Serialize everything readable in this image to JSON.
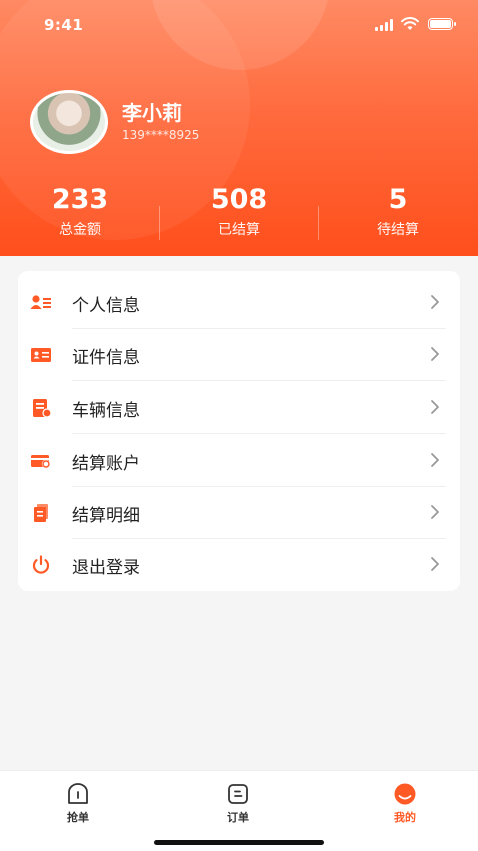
{
  "status_bar": {
    "time": "9:41"
  },
  "profile": {
    "name": "李小莉",
    "phone": "139****8925"
  },
  "stats": [
    {
      "value": "233",
      "label": "总金额"
    },
    {
      "value": "508",
      "label": "已结算"
    },
    {
      "value": "5",
      "label": "待结算"
    }
  ],
  "menu": {
    "items": [
      {
        "label": "个人信息",
        "icon": "person-card-icon"
      },
      {
        "label": "证件信息",
        "icon": "id-card-icon"
      },
      {
        "label": "车辆信息",
        "icon": "vehicle-doc-icon"
      },
      {
        "label": "结算账户",
        "icon": "wallet-card-icon"
      },
      {
        "label": "结算明细",
        "icon": "receipt-icon"
      },
      {
        "label": "退出登录",
        "icon": "power-icon"
      }
    ]
  },
  "tabbar": {
    "tabs": [
      {
        "label": "抢单",
        "icon": "grab-order-icon",
        "active": false
      },
      {
        "label": "订单",
        "icon": "order-icon",
        "active": false
      },
      {
        "label": "我的",
        "icon": "profile-icon",
        "active": true
      }
    ]
  },
  "colors": {
    "accent": "#ff5a26",
    "text": "#222222",
    "background": "#f5f5f5"
  }
}
